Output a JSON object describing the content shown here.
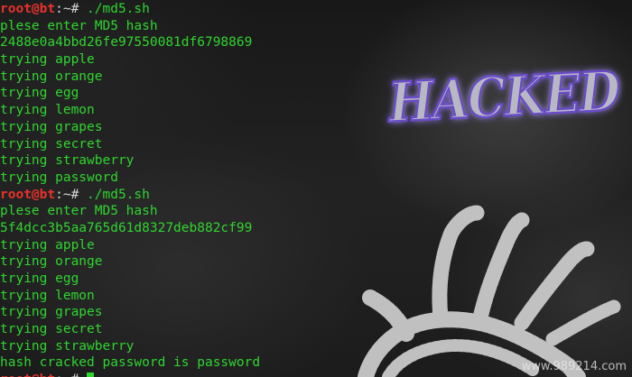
{
  "terminal": {
    "prompt_user": "root@bt",
    "prompt_path": ":~# ",
    "lines": [
      {
        "type": "prompt",
        "command": "./md5.sh"
      },
      {
        "type": "text",
        "text": "plese enter MD5 hash"
      },
      {
        "type": "text",
        "text": "2488e0a4bbd26fe97550081df6798869"
      },
      {
        "type": "text",
        "text": "trying apple"
      },
      {
        "type": "text",
        "text": "trying orange"
      },
      {
        "type": "text",
        "text": "trying egg"
      },
      {
        "type": "text",
        "text": "trying lemon"
      },
      {
        "type": "text",
        "text": "trying grapes"
      },
      {
        "type": "text",
        "text": "trying secret"
      },
      {
        "type": "text",
        "text": "trying strawberry"
      },
      {
        "type": "text",
        "text": "trying password"
      },
      {
        "type": "prompt",
        "command": "./md5.sh"
      },
      {
        "type": "text",
        "text": "plese enter MD5 hash"
      },
      {
        "type": "text",
        "text": "5f4dcc3b5aa765d61d8327deb882cf99"
      },
      {
        "type": "text",
        "text": "trying apple"
      },
      {
        "type": "text",
        "text": "trying orange"
      },
      {
        "type": "text",
        "text": "trying egg"
      },
      {
        "type": "text",
        "text": "trying lemon"
      },
      {
        "type": "text",
        "text": "trying grapes"
      },
      {
        "type": "text",
        "text": "trying secret"
      },
      {
        "type": "text",
        "text": "trying strawberry"
      },
      {
        "type": "text",
        "text": "hash cracked password is password"
      },
      {
        "type": "prompt",
        "command": ""
      }
    ]
  },
  "wallpaper": {
    "logo_text": "HACKED",
    "logo_color": "#b8b8c4",
    "logo_glow": "#6a4cc8",
    "hand_color": "#d2d2d2"
  },
  "watermark": {
    "text": "www.989214.com"
  },
  "colors": {
    "terminal_green": "#2fd52f",
    "prompt_red": "#e8322c",
    "prompt_path": "#d8d8d8"
  }
}
